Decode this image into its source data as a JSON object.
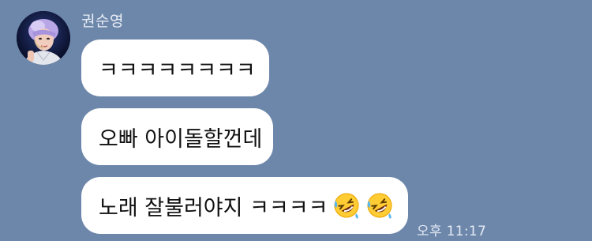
{
  "chat": {
    "sender_name": "권순영",
    "messages": [
      {
        "text": "ㅋㅋㅋㅋㅋㅋㅋㅋ",
        "emoji": []
      },
      {
        "text": "오빠 아이돌할껀데",
        "emoji": []
      },
      {
        "text": "노래 잘불러야지 ㅋㅋㅋㅋ",
        "emoji": [
          "rolling-on-floor-laughing-icon",
          "rolling-on-floor-laughing-icon"
        ]
      }
    ],
    "timestamp": "오후 11:17"
  },
  "colors": {
    "background": "#6d87ab",
    "bubble": "#ffffff",
    "sender_name": "#e8eef6",
    "timestamp": "#e2e9f3"
  }
}
